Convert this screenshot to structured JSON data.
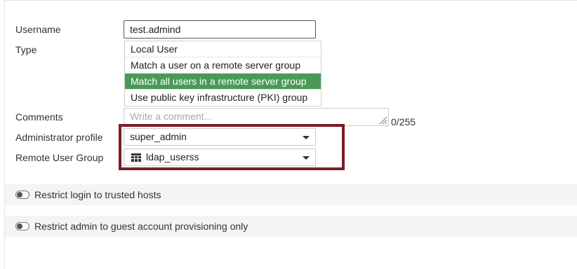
{
  "form": {
    "username": {
      "label": "Username",
      "value": "test.admind"
    },
    "type": {
      "label": "Type",
      "options": [
        "Local User",
        "Match a user on a remote server group",
        "Match all users in a remote server group",
        "Use public key infrastructure (PKI) group"
      ],
      "selected_index": 2
    },
    "comments": {
      "label": "Comments",
      "placeholder": "Write a comment...",
      "counter": "0/255"
    },
    "admin_profile": {
      "label": "Administrator profile",
      "value": "super_admin"
    },
    "remote_group": {
      "label": "Remote User Group",
      "value": "ldap_userss",
      "icon": "group-grid-icon"
    }
  },
  "toggles": [
    {
      "label": "Restrict login to trusted hosts",
      "enabled": false
    },
    {
      "label": "Restrict admin to guest account provisioning only",
      "enabled": false
    }
  ],
  "colors": {
    "selected_option": "#4a9a55",
    "highlight_border": "#7b1b28"
  }
}
